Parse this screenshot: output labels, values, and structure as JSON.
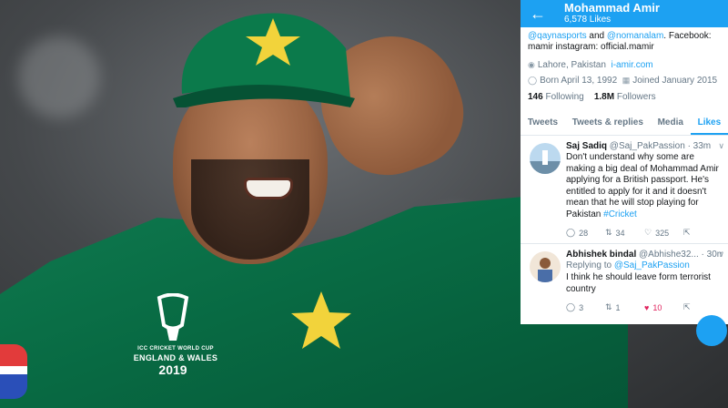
{
  "header": {
    "title": "Mohammad Amir",
    "likes": "6,578 Likes"
  },
  "profile": {
    "bio_mention1": "@qaynasports",
    "bio_and": " and ",
    "bio_mention2": "@nomanalam",
    "bio_rest": ". Facebook: mamir instagram: official.mamir",
    "location": "Lahore, Pakistan",
    "website": "i-amir.com",
    "born": "Born April 13, 1992",
    "joined": "Joined January 2015",
    "following_count": "146",
    "following_label": " Following",
    "followers_count": "1.8M",
    "followers_label": " Followers"
  },
  "tabs": [
    {
      "label": "Tweets"
    },
    {
      "label": "Tweets & replies"
    },
    {
      "label": "Media"
    },
    {
      "label": "Likes"
    }
  ],
  "tweets": [
    {
      "name": "Saj Sadiq",
      "handle": "@Saj_PakPassion",
      "time": "· 33m",
      "body": "Don't understand why some are making a big deal of Mohammad Amir applying for a British passport. He's entitled to apply for it and it doesn't mean that he will stop playing for Pakistan ",
      "hashtag": "#Cricket",
      "replies": "28",
      "retweets": "34",
      "likes": "325"
    },
    {
      "name": "Abhishek bindal",
      "handle": "@Abhishe32...",
      "time": "· 30m",
      "reply_prefix": "Replying to ",
      "reply_handle": "@Saj_PakPassion",
      "body": "I think he should leave form terrorist country",
      "replies": "3",
      "retweets": "1",
      "likes": "10"
    }
  ],
  "jersey": {
    "wc_line1": "ICC CRICKET WORLD CUP",
    "wc_line2": "ENGLAND & WALES",
    "wc_year": "2019"
  },
  "colors": {
    "twitter_blue": "#1da1f2",
    "jersey_green": "#0a6d45",
    "like_red": "#e0245e"
  },
  "icons": {
    "back": "arrow-left-icon",
    "reply": "reply-icon",
    "retweet": "retweet-icon",
    "like": "heart-icon",
    "share": "share-icon",
    "more": "chevron-down-icon"
  }
}
